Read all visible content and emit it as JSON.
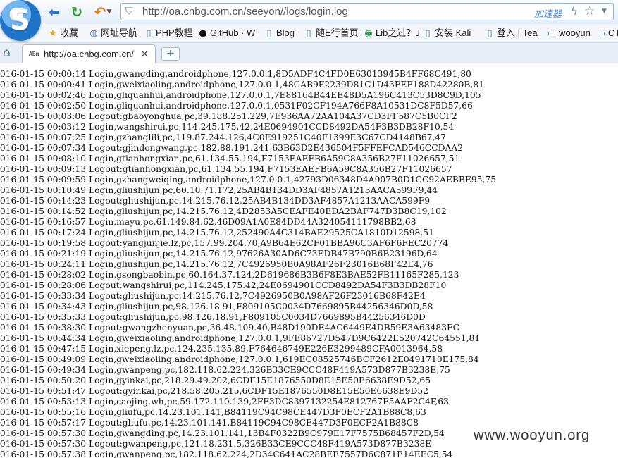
{
  "browser": {
    "logo_letter": "S",
    "address": "http://oa.cnbg.com.cn/seeyon//logs/login.log",
    "accelerator": "加速器",
    "bookmarks": [
      {
        "icon": "star-icon",
        "glyph": "★",
        "color": "#e3a91c",
        "label": "收藏"
      },
      {
        "icon": "globe-icon",
        "glyph": "◍",
        "color": "#5576a0",
        "label": "网址导航"
      },
      {
        "icon": "page-icon",
        "glyph": "▯",
        "color": "#5576a0",
        "label": "PHP教程"
      },
      {
        "icon": "github-icon",
        "glyph": "●",
        "color": "#111111",
        "label": "GitHub · W"
      },
      {
        "icon": "page-icon",
        "glyph": "▯",
        "color": "#5576a0",
        "label": "Blog"
      },
      {
        "icon": "page-icon",
        "glyph": "▯",
        "color": "#5576a0",
        "label": "随E行首页"
      },
      {
        "icon": "lib-icon",
        "glyph": "◉",
        "color": "#2aa34a",
        "label": "Lib之过？J"
      },
      {
        "icon": "page-icon",
        "glyph": "▯",
        "color": "#5576a0",
        "label": "安装 Kali"
      },
      {
        "icon": "page-icon",
        "glyph": "▯",
        "color": "#5576a0",
        "label": "登入 | Tea"
      },
      {
        "icon": "folder-icon",
        "glyph": "▭",
        "color": "#5576a0",
        "label": "wooyun"
      },
      {
        "icon": "folder-icon",
        "glyph": "▭",
        "color": "#5576a0",
        "label": "CT"
      }
    ],
    "tab": {
      "favicon": "ABm",
      "title": "http://oa.cnbg.com.cn/",
      "close": "×"
    },
    "new_tab": "+"
  },
  "log_lines": [
    "2016-01-15 00:00:14 Login,gwangding,androidphone,127.0.0.1,8D5ADF4C4FD0E63013945B4FF68C491,80",
    "2016-01-15 00:00:41 Login,gweixiaoling,androidphone,127.0.0.1,48CAB9F2239D81C1D43FEF188D42280B,81",
    "2016-01-15 00:02:46 Login,gliquanhui,androidphone,127.0.0.1,7E88164B44EE48D5A196C413C53D8C9D,105",
    "2016-01-15 00:02:50 Login,gliquanhui,androidphone,127.0.0.1,0531F02CF194A766F8A10531DC8F5D57,66",
    "2016-01-15 00:03:06 Logout:gbaoyonghua,pc,39.188.251.229,7E936AA72AA104A37CD3FF587C5B0CF2",
    "2016-01-15 00:03:12 Login,wangshirui,pc,114.245.175.42,24E0694901CCD8492DA54F3B3DB28F10,54",
    "2016-01-15 00:07:25 Login,gzhanglili,pc,119.87.244.126,4C0E919251C40F1399E3C67CD4148B67,47",
    "2016-01-15 00:07:34 Logout:gjindongwang,pc,182.88.191.241,63B63D2E436504F5FFEFCAD546CCDAA2",
    "2016-01-15 00:08:10 Login,gtianhongxian,pc,61.134.55.194,F7153EAEFB6A59C8A356B27F11026657,51",
    "2016-01-15 00:09:13 Logout:gtianhongxian,pc,61.134.55.194,F7153EAEFB6A59C8A356B27F11026657",
    "2016-01-15 00:09:59 Login,gzhangweiqing,androidphone,127.0.0.1,42793D06348D4A907B0D1CC92AEBBE95,75",
    "2016-01-15 00:10:49 Login,gliushijun,pc,60.10.71.172,25AB4B134DD3AF4857A1213AACA599F9,44",
    "2016-01-15 00:14:23 Logout:gliushijun,pc,14.215.76.12,25AB4B134DD3AF4857A1213AACA599F9",
    "2016-01-15 00:14:52 Login,gliushijun,pc,14.215.76.12,4D2853A5CEAFE40EDA2BAF747D3B8C19,102",
    "2016-01-15 00:16:57 Login,mayu,pc,61.149.84.62,46D09A1A0E84DD44A324054111798BB2,68",
    "2016-01-15 00:17:24 Login,gliushijun,pc,14.215.76.12,252490A4C314BAE29525CA1810D12598,51",
    "2016-01-15 00:19:58 Logout:yangjunjie.lz,pc,157.99.204.70,A9B64E62CF01BBA96C3AF6F6FEC20774",
    "2016-01-15 00:21:19 Login,gliushijun,pc,14.215.76.12,97626A30AD6C73EDB47B790B6B23196D,64",
    "2016-01-15 00:24:11 Login,gliushijun,pc,14.215.76.12,7C4926950B0A98AF26F23016B68F42E4,76",
    "2016-01-15 00:28:02 Login,gsongbaobin,pc,60.164.37.124,2D619686B3B6F8E3BAE52FB11165F285,123",
    "2016-01-15 00:28:06 Logout:wangshirui,pc,114.245.175.42,24E0694901CCD8492DA54F3B3DB28F10",
    "2016-01-15 00:33:34 Logout:gliushijun,pc,14.215.76.12,7C4926950B0A98AF26F23016B68F42E4",
    "2016-01-15 00:34:43 Login,gliushijun,pc,98.126.18.91,F809105C0034D7669895B44256346D0D,58",
    "2016-01-15 00:35:33 Logout:gliushijun,pc,98.126.18.91,F809105C0034D7669895B44256346D0D",
    "2016-01-15 00:38:30 Logout:gwangzhenyuan,pc,36.48.109.40,B48D190DE4AC6449E4DB59E3A63483FC",
    "2016-01-15 00:44:34 Login,gweixiaoling,androidphone,127.0.0.1,9FE86727D547D9C6422E520742C64551,81",
    "2016-01-15 00:47:15 Login,xiepeng.lz,pc,124.235.135.89,F764646749E226E3299489CFA0013964,58",
    "2016-01-15 00:49:09 Login,gweixiaoling,androidphone,127.0.0.1,619EC08525746BCF2612E0491710E175,84",
    "2016-01-15 00:49:34 Login,gwanpeng,pc,182.118.62.224,326B33CE9CCC48F419A573D877B3238E,75",
    "2016-01-15 00:50:20 Login,gyinkai,pc,218.29.49.202,6CDF15E1876550D8E15E50E6638E9D52,65",
    "2016-01-15 00:51:47 Logout:gyinkai,pc,218.58.205.215,6CDF15E1876550D8E15E50E6638E9D52",
    "2016-01-15 00:53:13 Login,caojing.wh,pc,59.172.110.139,2FF3DC8397132254E812767F5AAF2C4F,63",
    "2016-01-15 00:55:16 Login,gliufu,pc,14.23.101.141,B84119C94C98CE447D3F0ECF2A1B88C8,63",
    "2016-01-15 00:57:17 Logout:gliufu,pc,14.23.101.141,B84119C94C98CE447D3F0ECF2A1B88C8",
    "2016-01-15 00:57:30 Login,gwangding,pc,14.23.101.141,13B4F0322B9C979E17F7575B68457F2D,54",
    "2016-01-15 00:57:30 Logout:gwanpeng,pc,121.18.231.5,326B33CE9CCC48F419A573D877B3238E",
    "2016-01-15 00:57:38 Login,gwanpeng,pc,182.118.62.224,2D34C641AC28BEE7557D6C871E14EEC5,54"
  ],
  "watermark": "www.wooyun.org"
}
